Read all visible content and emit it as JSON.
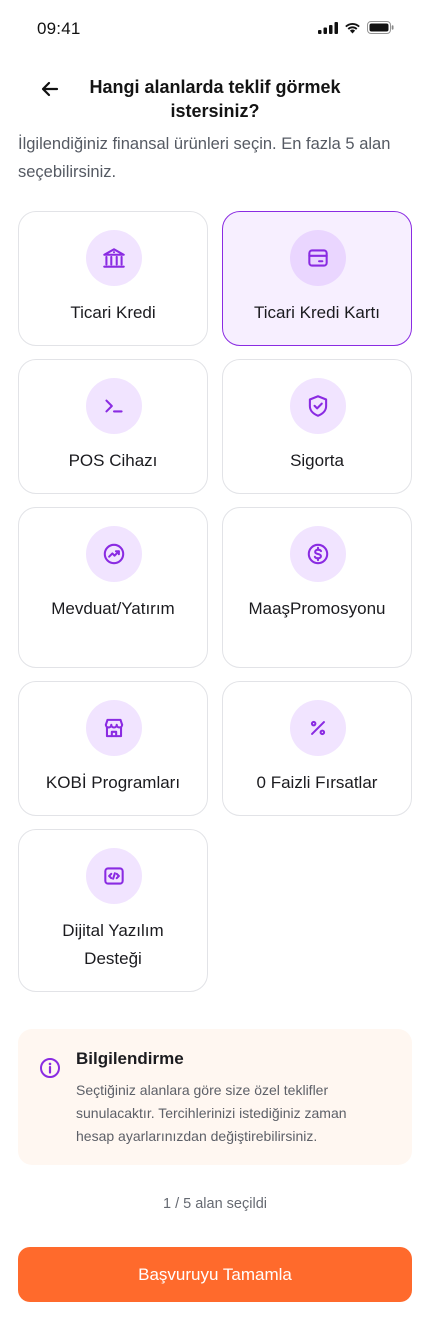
{
  "status_bar": {
    "time": "09:41"
  },
  "header": {
    "title": "Hangi alanlarda teklif görmek istersiniz?"
  },
  "subtitle": "İlgilendiğiniz finansal ürünleri seçin. En fazla 5 alan seçebilirsiniz.",
  "options": [
    {
      "label": "Ticari Kredi",
      "icon": "bank-icon",
      "selected": false
    },
    {
      "label": "Ticari Kredi Kartı",
      "icon": "credit-card-icon",
      "selected": true
    },
    {
      "label": "POS Cihazı",
      "icon": "terminal-icon",
      "selected": false
    },
    {
      "label": "Sigorta",
      "icon": "shield-check-icon",
      "selected": false
    },
    {
      "label": "Mevduat/Yatırım",
      "icon": "trending-up-icon",
      "selected": false
    },
    {
      "label": "MaaşPromosyonu",
      "icon": "dollar-icon",
      "selected": false
    },
    {
      "label": "KOBİ Programları",
      "icon": "store-icon",
      "selected": false
    },
    {
      "label": "0 Faizli Fırsatlar",
      "icon": "percent-icon",
      "selected": false
    },
    {
      "label": "Dijital Yazılım Desteği",
      "icon": "code-icon",
      "selected": false
    }
  ],
  "info": {
    "title": "Bilgilendirme",
    "text": "Seçtiğiniz alanlara göre size özel teklifler sunulacaktır. Tercihlerinizi istediğiniz zaman hesap ayarlarınızdan değiştirebilirsiniz."
  },
  "counter": "1 / 5 alan seçildi",
  "submit_label": "Başvuruyu Tamamla",
  "colors": {
    "accent": "#8a2be2",
    "accent_light": "#f1e4ff",
    "cta": "#ff6a2c",
    "info_bg": "#fff7f1"
  }
}
